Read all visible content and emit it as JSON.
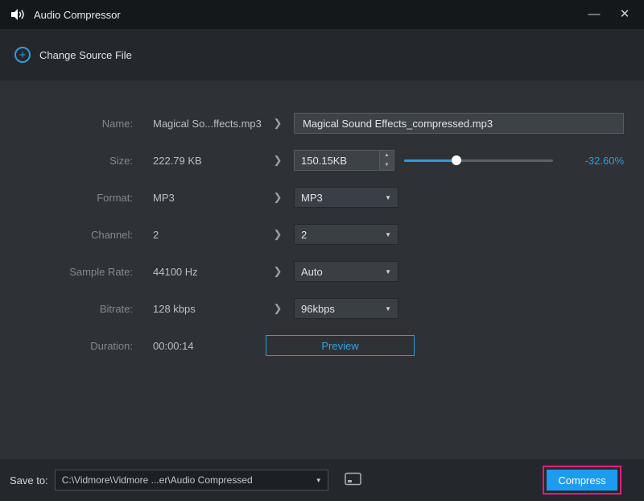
{
  "window": {
    "title": "Audio Compressor",
    "minimize_label": "—",
    "close_label": "✕"
  },
  "header": {
    "change_source_label": "Change Source File"
  },
  "fields": {
    "name": {
      "label": "Name:",
      "source": "Magical So...ffects.mp3",
      "value": "Magical Sound Effects_compressed.mp3"
    },
    "size": {
      "label": "Size:",
      "source": "222.79 KB",
      "value": "150.15KB",
      "reduction": "-32.60%",
      "slider_percent": 35
    },
    "format": {
      "label": "Format:",
      "source": "MP3",
      "value": "MP3"
    },
    "channel": {
      "label": "Channel:",
      "source": "2",
      "value": "2"
    },
    "sample_rate": {
      "label": "Sample Rate:",
      "source": "44100 Hz",
      "value": "Auto"
    },
    "bitrate": {
      "label": "Bitrate:",
      "source": "128 kbps",
      "value": "96kbps"
    },
    "duration": {
      "label": "Duration:",
      "source": "00:00:14",
      "preview_label": "Preview"
    }
  },
  "footer": {
    "save_to_label": "Save to:",
    "path": "C:\\Vidmore\\Vidmore ...er\\Audio Compressed",
    "compress_label": "Compress"
  },
  "colors": {
    "accent_blue": "#2d9cdb",
    "compress_blue": "#1d9bf0",
    "highlight_magenta": "#e5197e"
  }
}
